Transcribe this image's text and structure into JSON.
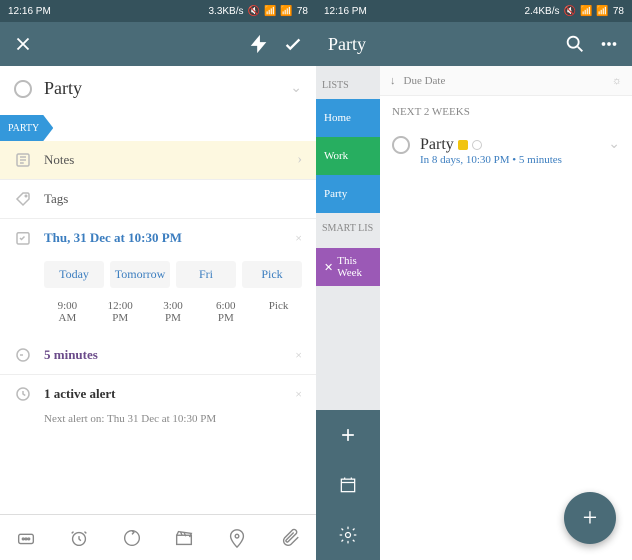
{
  "left": {
    "status": {
      "time": "12:16 PM",
      "net": "3.3KB/s",
      "battery": "78"
    },
    "task_title": "Party",
    "tab_label": "PARTY",
    "notes_label": "Notes",
    "tags_label": "Tags",
    "date_text": "Thu, 31 Dec at 10:30 PM",
    "chips": [
      "Today",
      "Tomorrow",
      "Fri",
      "Pick"
    ],
    "times": [
      [
        "9:00",
        "AM"
      ],
      [
        "12:00",
        "PM"
      ],
      [
        "3:00",
        "PM"
      ],
      [
        "6:00",
        "PM"
      ],
      [
        "Pick",
        ""
      ]
    ],
    "snooze": "5 minutes",
    "alert_title": "1 active alert",
    "alert_sub": "Next alert on: Thu 31 Dec at 10:30 PM"
  },
  "right": {
    "status": {
      "time": "12:16 PM",
      "net": "2.4KB/s",
      "battery": "78"
    },
    "title": "Party",
    "sort": "Due Date",
    "sidebar": {
      "hdr1": "LISTS",
      "home": "Home",
      "work": "Work",
      "party": "Party",
      "hdr2": "SMART LIS",
      "thisweek": "This Week"
    },
    "section": "NEXT 2 WEEKS",
    "task": {
      "name": "Party",
      "sub": "In 8 days, 10:30 PM • 5 minutes"
    }
  }
}
